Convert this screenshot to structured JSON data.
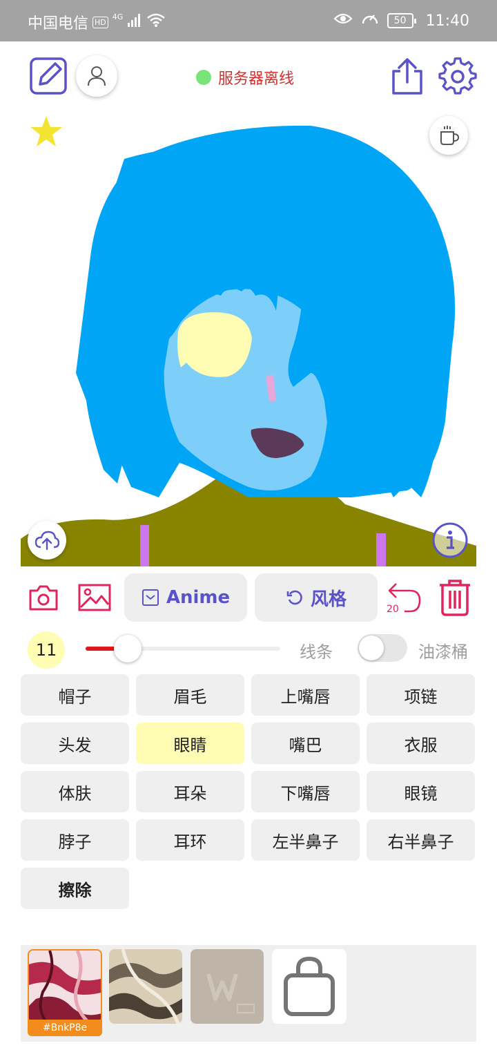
{
  "status_bar": {
    "carrier": "中国电信",
    "hd": "HD",
    "network": "4G",
    "battery": "50",
    "time": "11:40"
  },
  "header": {
    "server_status": "服务器离线",
    "status_color": "#7ae47a"
  },
  "toolbar": {
    "anime_label": "Anime",
    "style_label": "风格",
    "undo_count": "20"
  },
  "brush": {
    "size": "11",
    "size_fraction": 0.18,
    "line_label": "线条",
    "bucket_label": "油漆桶",
    "bucket_enabled": false
  },
  "parts": [
    {
      "label": "帽子"
    },
    {
      "label": "眉毛"
    },
    {
      "label": "上嘴唇"
    },
    {
      "label": "项链"
    },
    {
      "label": "头发"
    },
    {
      "label": "眼睛",
      "selected": true
    },
    {
      "label": "嘴巴"
    },
    {
      "label": "衣服"
    },
    {
      "label": "体肤"
    },
    {
      "label": "耳朵"
    },
    {
      "label": "下嘴唇"
    },
    {
      "label": "眼镜"
    },
    {
      "label": "脖子"
    },
    {
      "label": "耳环"
    },
    {
      "label": "左半鼻子"
    },
    {
      "label": "右半鼻子"
    },
    {
      "label": "擦除"
    }
  ],
  "style_tray": {
    "selected_tag": "#BnkP8e"
  },
  "colors": {
    "accent": "#5a52c8",
    "danger": "#e0245e",
    "hair": "#00a6f5",
    "skin": "#7dcffa",
    "eye": "#fffcb3",
    "shirt": "#888400",
    "mouth": "#5a3a58",
    "strap": "#cc77ee"
  }
}
